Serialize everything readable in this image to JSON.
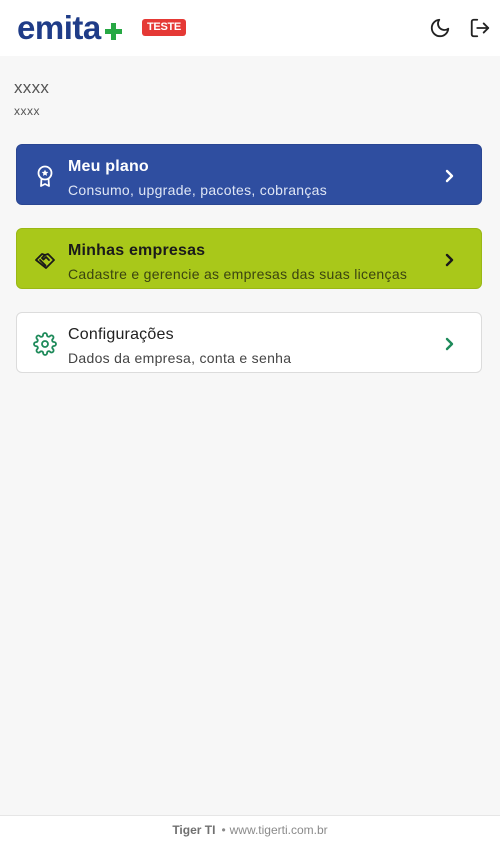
{
  "header": {
    "brand": "emita",
    "badge": "TESTE"
  },
  "user": {
    "name": "xxxx",
    "subtitle": "xxxx"
  },
  "menu": [
    {
      "title": "Meu plano",
      "subtitle": "Consumo, upgrade, pacotes, cobranças",
      "icon": "award-icon"
    },
    {
      "title": "Minhas empresas",
      "subtitle": "Cadastre e gerencie as empresas das suas licenças",
      "icon": "handshake-icon"
    },
    {
      "title": "Configurações",
      "subtitle": "Dados da empresa, conta e senha",
      "icon": "gear-icon"
    }
  ],
  "footer": {
    "company": "Tiger TI",
    "separator": "•",
    "site": "www.tigerti.com.br"
  },
  "colors": {
    "brand_blue": "#1f3c88",
    "brand_green": "#27a844",
    "plan_card": "#2f4ea0",
    "companies_card": "#a9c81a",
    "gear_green": "#1e8a5a",
    "badge_red": "#e53935"
  }
}
